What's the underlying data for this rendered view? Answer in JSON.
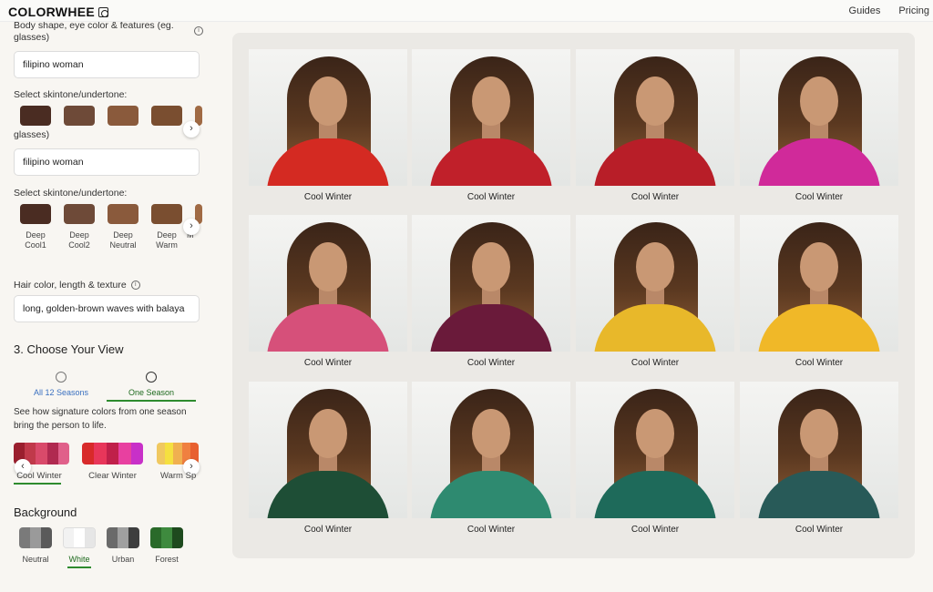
{
  "app": {
    "logo": "COLORWHEE",
    "nav": [
      "Guides",
      "Pricing"
    ]
  },
  "form": {
    "features_label": "Body shape, eye color & features (eg. glasses)",
    "features_value": "filipino woman",
    "skintone_label": "Select skintone/undertone:",
    "glasses_label": "glasses)",
    "features_value_2": "filipino woman",
    "skintone_label_2": "Select skintone/undertone:",
    "skintones": [
      {
        "name": "Deep Cool1",
        "color": "#4a2c22"
      },
      {
        "name": "Deep Cool2",
        "color": "#6e4a38"
      },
      {
        "name": "Deep Neutral",
        "color": "#8a5a3c"
      },
      {
        "name": "Deep Warm",
        "color": "#7a4e30"
      },
      {
        "name": "M",
        "color": "#a06a44"
      }
    ],
    "hair_label": "Hair color, length & texture",
    "hair_value": "long, golden-brown waves with balaya"
  },
  "view": {
    "heading": "3. Choose Your View",
    "tabs": [
      {
        "label": "All 12 Seasons",
        "icon": "palette-icon",
        "active": false
      },
      {
        "label": "One Season",
        "icon": "wheel-icon",
        "active": true
      }
    ],
    "description": "See how signature colors from one season bring the person to life.",
    "palettes": [
      {
        "name": "Cool Winter",
        "colors": [
          "#9a1f2e",
          "#c0394a",
          "#d94a6a",
          "#b02a50",
          "#e0608a"
        ]
      },
      {
        "name": "Clear Winter",
        "colors": [
          "#d82a2a",
          "#e8365a",
          "#c0204a",
          "#e840a0",
          "#c830c8"
        ]
      },
      {
        "name": "Warm Sp",
        "colors": [
          "#f0c860",
          "#f5e040",
          "#f0b050",
          "#f08040",
          "#e86030"
        ]
      }
    ]
  },
  "background": {
    "heading": "Background",
    "options": [
      {
        "name": "Neutral",
        "colors": [
          "#7a7a7a",
          "#9a9a9a",
          "#5a5a5a"
        ],
        "active": false
      },
      {
        "name": "White",
        "colors": [
          "#f2f2f2",
          "#ffffff",
          "#e6e6e6"
        ],
        "active": true
      },
      {
        "name": "Urban",
        "colors": [
          "#6a6a6a",
          "#a0a0a0",
          "#3e3e3e"
        ],
        "active": false
      },
      {
        "name": "Forest",
        "colors": [
          "#2a6a2a",
          "#3e8a3e",
          "#1e4a1e"
        ],
        "active": false
      }
    ]
  },
  "gallery": {
    "items": [
      {
        "caption": "Cool Winter",
        "shirt": "#d42a22"
      },
      {
        "caption": "Cool Winter",
        "shirt": "#c0202a"
      },
      {
        "caption": "Cool Winter",
        "shirt": "#b81e28"
      },
      {
        "caption": "Cool Winter",
        "shirt": "#d02a9a"
      },
      {
        "caption": "Cool Winter",
        "shirt": "#d6507a"
      },
      {
        "caption": "Cool Winter",
        "shirt": "#6a1a3a"
      },
      {
        "caption": "Cool Winter",
        "shirt": "#e8b82a"
      },
      {
        "caption": "Cool Winter",
        "shirt": "#f0b828"
      },
      {
        "caption": "Cool Winter",
        "shirt": "#1e4e36"
      },
      {
        "caption": "Cool Winter",
        "shirt": "#2e8a70"
      },
      {
        "caption": "Cool Winter",
        "shirt": "#1e6a5a"
      },
      {
        "caption": "Cool Winter",
        "shirt": "#285a58"
      }
    ]
  }
}
